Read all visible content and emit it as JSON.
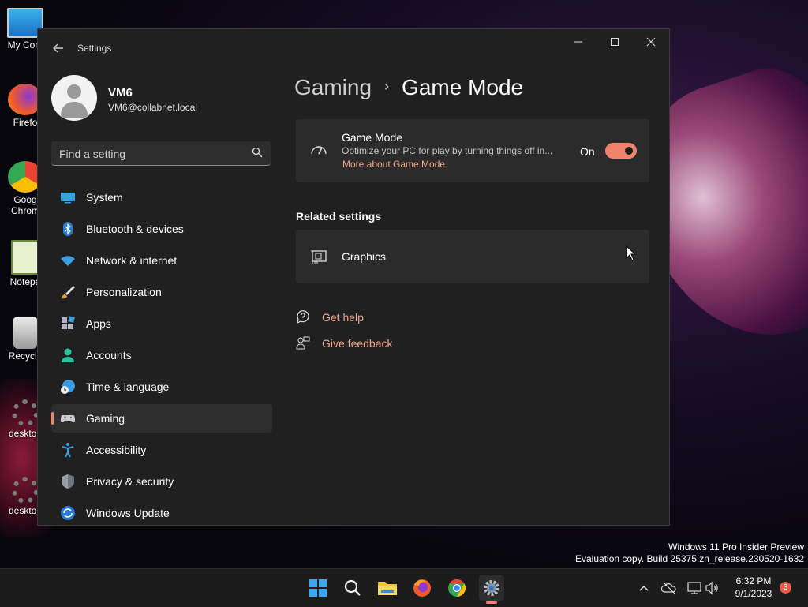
{
  "desktop": {
    "icons": [
      {
        "label": "My Com",
        "icon": "monitor-icon"
      },
      {
        "label": "Firefo",
        "icon": "firefox-icon"
      },
      {
        "label": "Goog",
        "label2": "Chrom",
        "icon": "chrome-icon"
      },
      {
        "label": "Notepa",
        "icon": "notepad-icon"
      },
      {
        "label": "Recycle",
        "icon": "recycle-bin-icon"
      },
      {
        "label": "desktop",
        "icon": "gear-icon"
      },
      {
        "label": "desktop",
        "icon": "gear-icon"
      }
    ]
  },
  "window": {
    "title": "Settings",
    "controls": {
      "minimize": "—",
      "maximize": "☐",
      "close": "✕"
    }
  },
  "user": {
    "name": "VM6",
    "email": "VM6@collabnet.local"
  },
  "search": {
    "placeholder": "Find a setting"
  },
  "nav": {
    "items": [
      {
        "label": "System",
        "icon": "system-icon",
        "selected": false
      },
      {
        "label": "Bluetooth & devices",
        "icon": "bluetooth-icon",
        "selected": false
      },
      {
        "label": "Network & internet",
        "icon": "wifi-icon",
        "selected": false
      },
      {
        "label": "Personalization",
        "icon": "brush-icon",
        "selected": false
      },
      {
        "label": "Apps",
        "icon": "apps-icon",
        "selected": false
      },
      {
        "label": "Accounts",
        "icon": "accounts-icon",
        "selected": false
      },
      {
        "label": "Time & language",
        "icon": "globe-clock-icon",
        "selected": false
      },
      {
        "label": "Gaming",
        "icon": "gamepad-icon",
        "selected": true
      },
      {
        "label": "Accessibility",
        "icon": "accessibility-icon",
        "selected": false
      },
      {
        "label": "Privacy & security",
        "icon": "shield-icon",
        "selected": false
      },
      {
        "label": "Windows Update",
        "icon": "update-icon",
        "selected": false
      }
    ]
  },
  "breadcrumb": {
    "parent": "Gaming",
    "separator": "›",
    "current": "Game Mode"
  },
  "game_mode": {
    "title": "Game Mode",
    "description": "Optimize your PC for play by turning things off in...",
    "link": "More about Game Mode",
    "state_label": "On",
    "enabled": true
  },
  "related": {
    "heading": "Related settings",
    "items": [
      {
        "label": "Graphics",
        "icon": "graphics-card-icon"
      }
    ]
  },
  "help_links": [
    {
      "label": "Get help",
      "icon": "help-icon"
    },
    {
      "label": "Give feedback",
      "icon": "feedback-icon"
    }
  ],
  "watermark": {
    "line1": "Windows 11 Pro Insider Preview",
    "line2": "Evaluation copy. Build 25375.zn_release.230520-1632"
  },
  "taskbar": {
    "apps": [
      "start-icon",
      "search-icon",
      "file-explorer-icon",
      "firefox-icon",
      "chrome-icon",
      "settings-icon"
    ],
    "active_app": "settings-icon",
    "tray": [
      "chevron-up-icon",
      "onedrive-offline-icon",
      "network-icon",
      "volume-icon"
    ],
    "time": "6:32 PM",
    "date": "9/1/2023",
    "notification_count": "3"
  },
  "colors": {
    "accent": "#f0846a",
    "link": "#f0a58a",
    "window_bg": "#202020",
    "card_bg": "#2b2b2b"
  }
}
